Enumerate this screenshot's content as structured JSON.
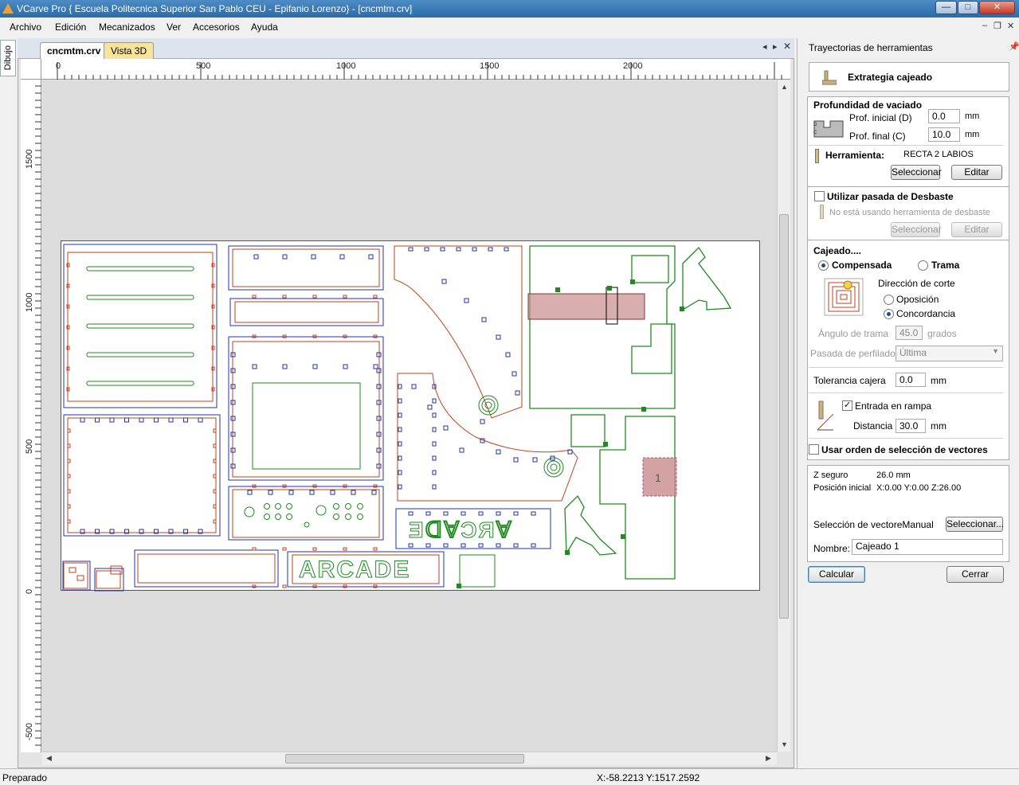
{
  "window": {
    "title": "VCarve Pro { Escuela Politecnica Superior San Pablo CEU - Epifanio Lorenzo} - [cncmtm.crv]",
    "btn_min": "—",
    "btn_max": "□",
    "btn_close": "✕"
  },
  "menu": {
    "items": [
      "Archivo",
      "Edición",
      "Mecanizados",
      "Ver",
      "Accesorios",
      "Ayuda"
    ]
  },
  "side_tab": {
    "label": "Dibujo"
  },
  "tabs": {
    "doc": "cncmtm.crv",
    "view3d": "Vista 3D"
  },
  "rulers": {
    "h": [
      "0",
      "500",
      "1000",
      "1500",
      "2000"
    ],
    "v": [
      "1500",
      "1000",
      "500",
      "0",
      "-500"
    ]
  },
  "canvas": {
    "text_arcade": "ARCADE",
    "text_arcade_mirror": "ƎᗡⱯƆЯⱯ",
    "marker": "1"
  },
  "panel": {
    "title": "Trayectorias de herramientas",
    "strategy": "Extrategia cajeado",
    "depth": {
      "heading": "Profundidad de vaciado",
      "start_label": "Prof. inicial (D)",
      "start_value": "0.0",
      "end_label": "Prof. final (C)",
      "end_value": "10.0",
      "unit": "mm"
    },
    "tool": {
      "label": "Herramienta:",
      "name": "RECTA 2 LABIOS",
      "select": "Seleccionar",
      "edit": "Editar"
    },
    "rough": {
      "label": "Utilizar pasada de Desbaste",
      "info": "No está usando herramienta de desbaste",
      "select": "Seleccionar",
      "edit": "Editar"
    },
    "pocket": {
      "heading": "Cajeado....",
      "opt1": "Compensada",
      "opt2": "Trama",
      "direction": "Dirección de corte",
      "dir1": "Oposición",
      "dir2": "Concordancia",
      "angle_label": "Ángulo de trama",
      "angle_value": "45.0",
      "angle_unit": "grados",
      "profile_label": "Pasada de perfilado",
      "profile_value": "Última"
    },
    "tolerance": {
      "label": "Tolerancia cajera",
      "value": "0.0",
      "unit": "mm"
    },
    "ramp": {
      "label": "Entrada en rampa",
      "dist_label": "Distancia",
      "dist_value": "30.0",
      "unit": "mm"
    },
    "order": {
      "label": "Usar orden de selección de vectores"
    },
    "info": {
      "zsafe_label": "Z seguro",
      "zsafe_value": "26.0 mm",
      "home_label": "Posición inicial",
      "home_value": "X:0.00 Y:0.00 Z:26.00"
    },
    "selection": {
      "label": "Selección de vectoreManual",
      "button": "Seleccionar..."
    },
    "name": {
      "label": "Nombre:",
      "value": "Cajeado 1"
    },
    "calc": "Calcular",
    "close": "Cerrar"
  },
  "status": {
    "text": "Preparado",
    "coords": "X:-58.2213 Y:1517.2592"
  },
  "colors": {
    "cut_green": "#1f8a1f",
    "tab_blue": "#2233aa",
    "outline_red": "#c2401a",
    "selection_fill": "#c98b8b"
  }
}
